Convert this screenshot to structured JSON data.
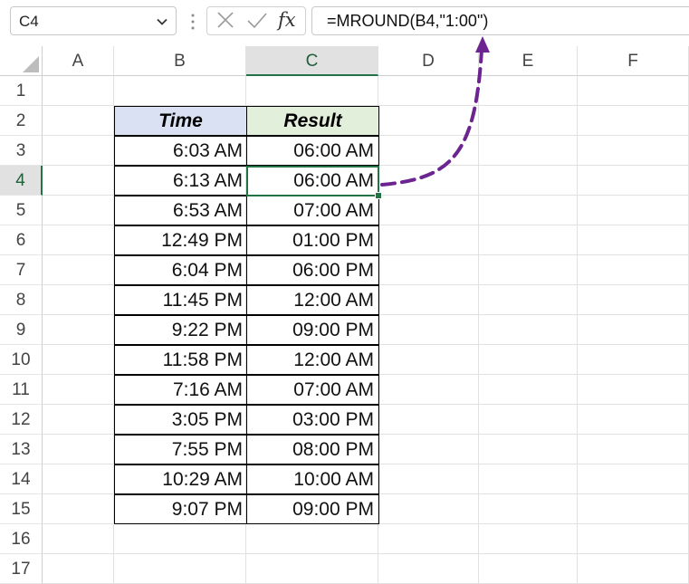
{
  "formula_bar": {
    "name_box": "C4",
    "fx_label": "fx",
    "formula": "=MROUND(B4,\"1:00\")"
  },
  "columns": [
    "A",
    "B",
    "C",
    "D",
    "E",
    "F"
  ],
  "rows": [
    "1",
    "2",
    "3",
    "4",
    "5",
    "6",
    "7",
    "8",
    "9",
    "10",
    "11",
    "12",
    "13",
    "14",
    "15",
    "16",
    "17"
  ],
  "selection": {
    "cell": "C4",
    "column": "C",
    "row": "4"
  },
  "table": {
    "headers": [
      "Time",
      "Result"
    ],
    "header_colors": {
      "time": "#d9e1f2",
      "result": "#e2efda"
    },
    "rows": [
      [
        "6:03 AM",
        "06:00 AM"
      ],
      [
        "6:13 AM",
        "06:00 AM"
      ],
      [
        "6:53 AM",
        "07:00 AM"
      ],
      [
        "12:49 PM",
        "01:00 PM"
      ],
      [
        "6:04 PM",
        "06:00 PM"
      ],
      [
        "11:45 PM",
        "12:00 AM"
      ],
      [
        "9:22 PM",
        "09:00 PM"
      ],
      [
        "11:58 PM",
        "12:00 AM"
      ],
      [
        "7:16 AM",
        "07:00 AM"
      ],
      [
        "3:05 PM",
        "03:00 PM"
      ],
      [
        "7:55 PM",
        "08:00 PM"
      ],
      [
        "10:29 AM",
        "10:00 AM"
      ],
      [
        "9:07 PM",
        "09:00 PM"
      ]
    ]
  },
  "colors": {
    "accent": "#217346",
    "arrow": "#6b2490"
  },
  "icons": [
    "chevron-down-icon",
    "cancel-icon",
    "enter-icon",
    "function-icon",
    "select-all-icon",
    "arrow-annotation-icon"
  ]
}
